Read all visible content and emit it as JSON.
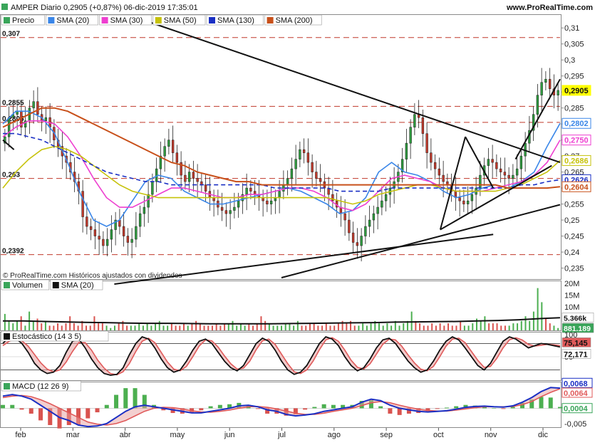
{
  "header": {
    "title": "AMPER Diario 0,2905 (+0,87%) 06-dic-2019 17:35:01",
    "site": "www.ProRealTime.com"
  },
  "main_legend": [
    {
      "label": "Precio",
      "color": "#3aa55a"
    },
    {
      "label": "SMA (20)",
      "color": "#3a86e8"
    },
    {
      "label": "SMA (30)",
      "color": "#ee3fd0"
    },
    {
      "label": "SMA (50)",
      "color": "#c6c20a"
    },
    {
      "label": "SMA (130)",
      "color": "#1a2fc4"
    },
    {
      "label": "SMA (200)",
      "color": "#c8501a"
    }
  ],
  "copyright": "© ProRealTime.com  Históricos ajustados con dividendos",
  "volume_legend": [
    {
      "label": "Volumen",
      "color": "#3aa55a"
    },
    {
      "label": "SMA (20)",
      "color": "#111111"
    }
  ],
  "stoch_legend": [
    {
      "label": "Estocástico (14 3 5)",
      "color": "#111111"
    }
  ],
  "macd_legend": [
    {
      "label": "MACD (12 26 9)",
      "color": "#3aa55a"
    }
  ],
  "colors": {
    "up": "#2e9a3e",
    "down": "#c0392b",
    "hline": "#c0392b",
    "trend": "#111111",
    "badge_price": "#ffff00"
  },
  "chart_data": [
    {
      "type": "candlestick",
      "panel": "price",
      "x": [
        "feb",
        "mar",
        "abr",
        "may",
        "jun",
        "jul",
        "ago",
        "sep",
        "oct",
        "nov",
        "dic"
      ],
      "yticks": [
        "0,31",
        "0,305",
        "0,3",
        "0,295",
        "0,29",
        "0,285",
        "0,28",
        "0,275",
        "0,27",
        "0,265",
        "0,26",
        "0,255",
        "0,25",
        "0,245",
        "0,24",
        "0,235"
      ],
      "ylim": [
        0.232,
        0.3125
      ],
      "levels": [
        {
          "value": 0.307,
          "label": "0,307"
        },
        {
          "value": 0.2855,
          "label": "0,2855"
        },
        {
          "value": 0.2805,
          "label": "0,2805"
        },
        {
          "value": 0.263,
          "label": "0,263"
        },
        {
          "value": 0.2392,
          "label": "0,2392"
        }
      ],
      "badges": [
        {
          "label": "0,2905",
          "value": 0.2905,
          "color": "#ffff00"
        },
        {
          "label": "0,2802",
          "value": 0.2802,
          "color": "#3a86e8"
        },
        {
          "label": "0,2750",
          "value": 0.275,
          "color": "#ee3fd0"
        },
        {
          "label": "0,2686",
          "value": 0.2686,
          "color": "#c6c20a"
        },
        {
          "label": "0,2626",
          "value": 0.2626,
          "color": "#1a2fc4"
        },
        {
          "label": "0,2604",
          "value": 0.2604,
          "color": "#c8501a"
        }
      ],
      "series": [
        {
          "name": "Precio",
          "values": [
            0.276,
            0.282,
            0.283,
            0.284,
            0.279,
            0.281,
            0.285,
            0.287,
            0.283,
            0.281,
            0.282,
            0.279,
            0.275,
            0.273,
            0.27,
            0.268,
            0.265,
            0.262,
            0.259,
            0.251,
            0.248,
            0.247,
            0.245,
            0.244,
            0.242,
            0.244,
            0.247,
            0.25,
            0.248,
            0.245,
            0.243,
            0.244,
            0.248,
            0.252,
            0.254,
            0.258,
            0.262,
            0.266,
            0.27,
            0.273,
            0.275,
            0.271,
            0.268,
            0.264,
            0.262,
            0.265,
            0.263,
            0.262,
            0.261,
            0.259,
            0.257,
            0.256,
            0.254,
            0.253,
            0.252,
            0.253,
            0.254,
            0.256,
            0.258,
            0.26,
            0.259,
            0.258,
            0.257,
            0.256,
            0.255,
            0.256,
            0.257,
            0.259,
            0.261,
            0.263,
            0.266,
            0.269,
            0.272,
            0.271,
            0.268,
            0.265,
            0.263,
            0.262,
            0.26,
            0.258,
            0.256,
            0.254,
            0.252,
            0.25,
            0.246,
            0.243,
            0.242,
            0.245,
            0.248,
            0.25,
            0.252,
            0.254,
            0.256,
            0.258,
            0.26,
            0.262,
            0.265,
            0.269,
            0.274,
            0.279,
            0.283,
            0.282,
            0.277,
            0.271,
            0.268,
            0.266,
            0.264,
            0.262,
            0.261,
            0.259,
            0.257,
            0.256,
            0.255,
            0.256,
            0.258,
            0.26,
            0.264,
            0.267,
            0.269,
            0.268,
            0.266,
            0.265,
            0.264,
            0.263,
            0.264,
            0.266,
            0.27,
            0.274,
            0.278,
            0.283,
            0.289,
            0.293,
            0.294,
            0.291,
            0.289,
            0.2905
          ]
        },
        {
          "name": "SMA (20)",
          "values": [
            0.28,
            0.284,
            0.284,
            0.282,
            0.277,
            0.268,
            0.258,
            0.25,
            0.248,
            0.25,
            0.256,
            0.262,
            0.264,
            0.263,
            0.259,
            0.257,
            0.255,
            0.255,
            0.256,
            0.257,
            0.258,
            0.259,
            0.26,
            0.259,
            0.257,
            0.255,
            0.252,
            0.253,
            0.257,
            0.265,
            0.268,
            0.265,
            0.264,
            0.262,
            0.259,
            0.257,
            0.258,
            0.26,
            0.261,
            0.26,
            0.262,
            0.265,
            0.273,
            0.2802
          ]
        },
        {
          "name": "SMA (30)",
          "values": [
            0.276,
            0.279,
            0.281,
            0.281,
            0.28,
            0.276,
            0.27,
            0.263,
            0.257,
            0.254,
            0.254,
            0.256,
            0.258,
            0.26,
            0.26,
            0.259,
            0.258,
            0.257,
            0.257,
            0.258,
            0.258,
            0.259,
            0.26,
            0.26,
            0.259,
            0.257,
            0.254,
            0.253,
            0.255,
            0.259,
            0.263,
            0.264,
            0.263,
            0.262,
            0.26,
            0.259,
            0.259,
            0.259,
            0.26,
            0.261,
            0.262,
            0.264,
            0.268,
            0.275
          ]
        },
        {
          "name": "SMA (50)",
          "values": [
            0.26,
            0.265,
            0.269,
            0.272,
            0.273,
            0.272,
            0.27,
            0.267,
            0.264,
            0.261,
            0.259,
            0.258,
            0.257,
            0.257,
            0.257,
            0.257,
            0.257,
            0.257,
            0.257,
            0.257,
            0.257,
            0.257,
            0.257,
            0.257,
            0.257,
            0.257,
            0.256,
            0.255,
            0.256,
            0.258,
            0.259,
            0.26,
            0.261,
            0.261,
            0.26,
            0.259,
            0.259,
            0.259,
            0.259,
            0.26,
            0.261,
            0.263,
            0.265,
            0.2686
          ]
        },
        {
          "name": "SMA (130)",
          "values": [
            0.277,
            0.277,
            0.276,
            0.275,
            0.273,
            0.271,
            0.269,
            0.267,
            0.265,
            0.264,
            0.263,
            0.262,
            0.262,
            0.261,
            0.261,
            0.261,
            0.261,
            0.261,
            0.261,
            0.261,
            0.261,
            0.26,
            0.26,
            0.26,
            0.26,
            0.26,
            0.259,
            0.259,
            0.259,
            0.259,
            0.26,
            0.26,
            0.26,
            0.26,
            0.26,
            0.26,
            0.26,
            0.26,
            0.26,
            0.26,
            0.261,
            0.261,
            0.262,
            0.2626
          ]
        },
        {
          "name": "SMA (200)",
          "values": [
            0.279,
            0.281,
            0.283,
            0.285,
            0.285,
            0.284,
            0.282,
            0.28,
            0.278,
            0.276,
            0.274,
            0.272,
            0.27,
            0.268,
            0.267,
            0.265,
            0.264,
            0.263,
            0.262,
            0.262,
            0.261,
            0.261,
            0.261,
            0.261,
            0.261,
            0.261,
            0.261,
            0.261,
            0.261,
            0.261,
            0.261,
            0.261,
            0.261,
            0.261,
            0.261,
            0.261,
            0.261,
            0.261,
            0.261,
            0.26,
            0.26,
            0.26,
            0.26,
            0.2604
          ]
        }
      ]
    },
    {
      "type": "bar",
      "panel": "volume",
      "yticks": [
        "20M",
        "15M",
        "10M",
        "5M"
      ],
      "ylim": [
        0,
        20000000
      ],
      "badges": [
        {
          "label": "5.366k",
          "value": 5366000,
          "color": "#ffffff"
        },
        {
          "label": "881.189",
          "value": 881189,
          "color": "#3aa55a"
        }
      ],
      "values_millions": [
        7,
        4,
        3,
        4,
        6,
        2,
        8,
        4,
        5,
        3,
        4,
        2,
        2,
        3,
        2,
        3,
        6,
        3,
        2,
        4,
        2,
        2,
        6,
        3,
        3,
        2,
        1,
        2,
        3,
        4,
        2,
        2,
        2,
        3,
        2,
        3,
        2,
        3,
        4,
        2,
        2,
        3,
        2,
        2,
        3,
        2,
        3,
        4,
        3,
        2,
        2,
        2,
        3,
        2,
        3,
        3,
        4,
        2,
        3,
        2,
        3,
        2,
        3,
        6,
        4,
        3,
        2,
        2,
        2,
        3,
        3,
        2,
        4,
        2,
        2,
        3,
        3,
        2,
        2,
        3,
        2,
        2,
        3,
        4,
        3,
        4,
        2,
        2,
        3,
        2,
        3,
        4,
        3,
        2,
        3,
        2,
        4,
        2,
        3,
        4,
        8,
        4,
        3,
        2,
        2,
        3,
        2,
        3,
        2,
        3,
        2,
        2,
        4,
        2,
        2,
        3,
        5,
        4,
        6,
        3,
        3,
        3,
        2,
        2,
        2,
        3,
        3,
        4,
        6,
        4,
        8,
        18,
        12,
        5,
        3,
        2,
        1
      ],
      "sma20_millions": [
        4,
        4,
        3.8,
        3.6,
        3.4,
        3.3,
        3.1,
        3,
        3,
        2.9,
        2.8,
        2.8,
        2.8,
        2.8,
        2.9,
        3,
        3.1,
        3.2,
        3.3,
        3.5,
        3.6,
        3.7,
        3.8,
        4,
        4.2,
        4.5,
        5,
        5.366
      ]
    },
    {
      "type": "line",
      "panel": "stochastic",
      "yticks": [
        "100",
        "50"
      ],
      "ylim": [
        0,
        100
      ],
      "badges": [
        {
          "label": "75,145",
          "value": 75.145,
          "color": "#e05a5a"
        },
        {
          "label": "72,171",
          "value": 72.171,
          "color": "#ffffff"
        }
      ],
      "series": [
        {
          "name": "%K",
          "values": [
            80,
            95,
            92,
            80,
            60,
            35,
            20,
            12,
            15,
            30,
            60,
            85,
            90,
            70,
            45,
            25,
            12,
            8,
            10,
            25,
            55,
            80,
            95,
            90,
            70,
            45,
            25,
            15,
            20,
            40,
            65,
            85,
            90,
            80,
            60,
            40,
            25,
            18,
            30,
            55,
            80,
            92,
            85,
            65,
            40,
            20,
            10,
            15,
            30,
            55,
            80,
            95,
            90,
            75,
            50,
            30,
            18,
            25,
            45,
            70,
            88,
            92,
            80,
            60,
            40,
            25,
            15,
            20,
            40,
            65,
            85,
            95,
            88,
            70,
            50,
            30,
            20,
            35,
            60,
            85,
            95,
            90,
            80,
            70,
            75,
            80,
            78,
            75,
            72
          ]
        },
        {
          "name": "%D",
          "values": [
            75,
            85,
            90,
            86,
            74,
            55,
            36,
            22,
            16,
            20,
            38,
            62,
            82,
            82,
            65,
            42,
            24,
            12,
            9,
            16,
            35,
            62,
            85,
            92,
            82,
            60,
            38,
            22,
            18,
            28,
            50,
            74,
            88,
            86,
            72,
            52,
            34,
            22,
            24,
            40,
            66,
            86,
            90,
            78,
            56,
            34,
            16,
            12,
            20,
            40,
            66,
            88,
            93,
            85,
            65,
            42,
            26,
            22,
            34,
            56,
            78,
            90,
            88,
            74,
            54,
            36,
            22,
            18,
            28,
            50,
            74,
            90,
            92,
            82,
            62,
            42,
            26,
            28,
            46,
            70,
            88,
            93,
            88,
            78,
            74,
            76,
            78,
            77,
            75.145
          ]
        }
      ]
    },
    {
      "type": "line",
      "panel": "macd",
      "yticks": [
        "-0,005"
      ],
      "ylim": [
        -0.0062,
        0.0078
      ],
      "badges": [
        {
          "label": "0,0068",
          "value": 0.0068,
          "color": "#1a2fc4"
        },
        {
          "label": "0,0064",
          "value": 0.0064,
          "color": "#e05a5a"
        },
        {
          "label": "0,0004",
          "value": 0.0004,
          "color": "#3aa55a"
        }
      ],
      "series": [
        {
          "name": "MACD",
          "values": [
            0.004,
            0.0045,
            0.004,
            0.003,
            0.001,
            -0.001,
            -0.003,
            -0.004,
            -0.0055,
            -0.006,
            -0.0058,
            -0.005,
            -0.003,
            -0.001,
            0.0005,
            0.001,
            0.0005,
            0,
            -0.0005,
            -0.001,
            -0.0015,
            -0.0015,
            -0.001,
            -0.0005,
            0,
            0.0008,
            0.001,
            0.0005,
            -0.0005,
            -0.001,
            -0.002,
            -0.0025,
            -0.0022,
            -0.0018,
            -0.001,
            -0.0005,
            0,
            0.0005,
            0.002,
            0.003,
            0.0025,
            0.001,
            0,
            -0.0005,
            -0.001,
            -0.0012,
            -0.001,
            -0.0008,
            -0.0003,
            0.0003,
            0.0006,
            0.0007,
            0.0005,
            0.0004,
            0.0008,
            0.002,
            0.0035,
            0.0055,
            0.0068,
            0.0066
          ]
        },
        {
          "name": "Señal",
          "values": [
            0.0035,
            0.004,
            0.0042,
            0.0038,
            0.0028,
            0.0015,
            0,
            -0.0015,
            -0.003,
            -0.0045,
            -0.0052,
            -0.0055,
            -0.005,
            -0.004,
            -0.0025,
            -0.001,
            0,
            0.0003,
            0.0002,
            -0.0002,
            -0.0008,
            -0.0012,
            -0.0013,
            -0.001,
            -0.0006,
            0,
            0.0005,
            0.0006,
            0.0003,
            -0.0002,
            -0.0009,
            -0.0016,
            -0.002,
            -0.002,
            -0.0016,
            -0.001,
            -0.0005,
            0,
            0.0009,
            0.0018,
            0.0022,
            0.0018,
            0.001,
            0.0003,
            -0.0003,
            -0.0007,
            -0.0009,
            -0.0009,
            -0.0006,
            -0.0002,
            0.0002,
            0.0005,
            0.0005,
            0.0005,
            0.0006,
            0.0012,
            0.0022,
            0.0038,
            0.0052,
            0.0064
          ]
        }
      ]
    }
  ]
}
